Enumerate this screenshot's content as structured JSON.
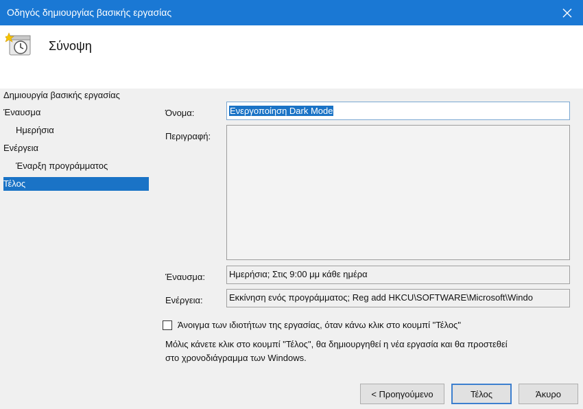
{
  "window": {
    "title": "Οδηγός δημιουργίας βασικής εργασίας"
  },
  "header": {
    "title": "Σύνοψη",
    "icon": "task-scheduler-clock-icon"
  },
  "sidebar": {
    "items": [
      {
        "label": "Δημιουργία βασικής εργασίας",
        "selected": false
      },
      {
        "label": "Έναυσμα",
        "selected": false
      },
      {
        "label": "Ημερήσια",
        "selected": false
      },
      {
        "label": "Ενέργεια",
        "selected": false
      },
      {
        "label": "Έναρξη προγράμματος",
        "selected": false
      },
      {
        "label": "Τέλος",
        "selected": true
      }
    ]
  },
  "form": {
    "name_label": "Όνομα:",
    "name_value": "Ενεργοποίηση Dark Mode",
    "description_label": "Περιγραφή:",
    "description_value": "",
    "trigger_label": "Έναυσμα:",
    "trigger_value": "Ημερήσια; Στις 9:00 μμ κάθε ημέρα",
    "action_label": "Ενέργεια:",
    "action_value": "Εκκίνηση ενός προγράμματος; Reg add HKCU\\SOFTWARE\\Microsoft\\Windo"
  },
  "options": {
    "checkbox_label": "Άνοιγμα των ιδιοτήτων της εργασίας, όταν κάνω κλικ στο κουμπί \"Τέλος\"",
    "checkbox_checked": false,
    "info_line1": "Μόλις κάνετε κλικ στο κουμπί \"Τέλος\", θα δημιουργηθεί η νέα εργασία και θα προστεθεί",
    "info_line2": "στο χρονοδιάγραμμα των Windows."
  },
  "buttons": {
    "back": "< Προηγούμενο",
    "finish": "Τέλος",
    "cancel": "Άκυρο"
  },
  "colors": {
    "titlebar": "#1a78d4",
    "selection": "#1a73c6"
  }
}
